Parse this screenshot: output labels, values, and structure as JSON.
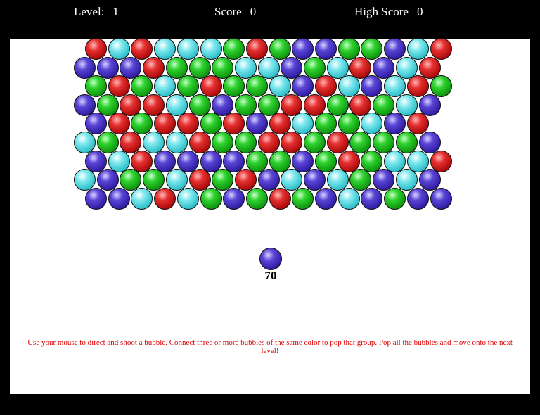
{
  "hud": {
    "level_label": "Level:",
    "level_value": "1",
    "score_label": "Score",
    "score_value": "0",
    "high_score_label": "High Score",
    "high_score_value": "0"
  },
  "colors": {
    "R": "#d41a1a",
    "C": "#55d6dd",
    "G": "#1fb81f",
    "B": "#4330c0"
  },
  "grid_rows": [
    "RCRCCCGRGBBGGBCR",
    "BBBRGGGCCBGCRBCR",
    "GRGCGRGGCBRCBCRG",
    "BGRRCGBGGRRGRGCB",
    "BRGRRGRBRCGGCBR",
    "CGRCCRGGRRGRGGGB",
    "BCRBBBBGGBGRGCCR",
    "CBGGCRGRBCBCGBCB",
    "BBCRCGBGRGBCBGBB"
  ],
  "shooter": {
    "color": "B",
    "shots_left": "70"
  },
  "instructions": "Use your mouse to direct and shoot a bubble. Connect three or more bubbles of the same color to pop that group. Pop all the bubbles and move onto the next level!"
}
